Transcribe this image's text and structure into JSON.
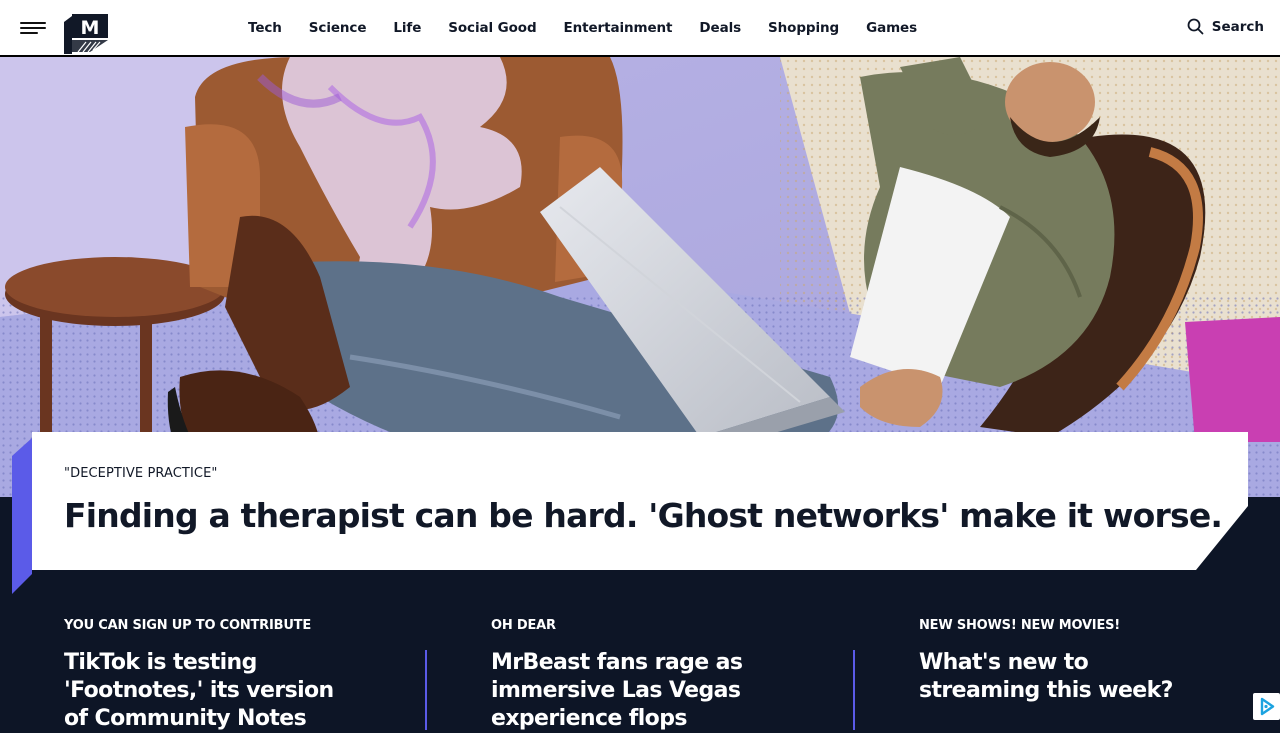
{
  "brand": {
    "logo_letter": "M",
    "logo_alt": "Mashable"
  },
  "nav": {
    "menu_icon": "hamburger-menu-icon",
    "items": [
      "Tech",
      "Science",
      "Life",
      "Social Good",
      "Entertainment",
      "Deals",
      "Shopping",
      "Games"
    ],
    "search_label": "Search",
    "search_icon": "search-icon"
  },
  "hero": {
    "kicker": "\"DECEPTIVE PRACTICE\"",
    "headline": "Finding a therapist can be hard. 'Ghost networks' make it worse."
  },
  "stories": [
    {
      "kicker": "YOU CAN SIGN UP TO CONTRIBUTE",
      "title": "TikTok is testing 'Footnotes,' its version of Community Notes"
    },
    {
      "kicker": "OH DEAR",
      "title": "MrBeast fans rage as immersive Las Vegas experience flops"
    },
    {
      "kicker": "NEW SHOWS! NEW MOVIES!",
      "title": "What's new to streaming this week?"
    }
  ],
  "colors": {
    "accent": "#5b5be8",
    "dark_bg": "#0d1526",
    "text_dark": "#111827"
  },
  "ad": {
    "icon": "adchoices-icon"
  }
}
